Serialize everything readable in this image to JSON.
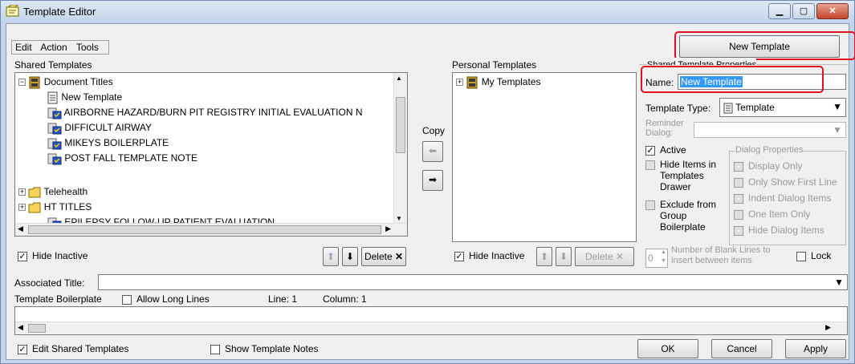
{
  "window": {
    "title": "Template Editor"
  },
  "menu": {
    "items": [
      "Edit",
      "Action",
      "Tools"
    ]
  },
  "toolbar": {
    "new_template_label": "New Template"
  },
  "shared": {
    "label": "Shared Templates",
    "tree": [
      {
        "label": "Document Titles",
        "expander": "−"
      },
      {
        "label": "New Template"
      },
      {
        "label": "AIRBORNE HAZARD/BURN PIT REGISTRY INITIAL EVALUATION N"
      },
      {
        "label": "DIFFICULT AIRWAY"
      },
      {
        "label": "MIKEYS BOILERPLATE"
      },
      {
        "label": "POST FALL TEMPLATE NOTE"
      },
      {
        "label": "Telehealth",
        "expander": "+"
      },
      {
        "label": "HT TITLES",
        "expander": "+"
      },
      {
        "label": "EPILEPSY FOLLOW-UP PATIENT EVALUATION"
      }
    ],
    "hide_inactive_label": "Hide Inactive",
    "delete_label": "Delete"
  },
  "copy": {
    "label": "Copy"
  },
  "personal": {
    "label": "Personal Templates",
    "tree": [
      {
        "label": "My Templates",
        "expander": "+"
      }
    ],
    "hide_inactive_label": "Hide Inactive",
    "delete_label": "Delete"
  },
  "properties": {
    "label": "Shared Template Properties",
    "name_label": "Name:",
    "name_value": "New Template",
    "template_type_label": "Template Type:",
    "template_type_value": "Template",
    "reminder_dialog_label": "Reminder Dialog:",
    "active_label": "Active",
    "hide_items_label": "Hide Items in Templates Drawer",
    "exclude_label": "Exclude from Group Boilerplate",
    "dialog_properties": {
      "label": "Dialog Properties",
      "options": [
        "Display Only",
        "Only Show First Line",
        "Indent Dialog Items",
        "One Item Only",
        "Hide Dialog Items"
      ]
    },
    "blank_lines_value": "0",
    "blank_lines_label": "Number of Blank Lines to insert between items",
    "lock_label": "Lock"
  },
  "associated_title": {
    "label": "Associated Title:",
    "value": ""
  },
  "boilerplate": {
    "label": "Template Boilerplate",
    "allow_long_lines_label": "Allow Long Lines",
    "line_label": "Line: 1",
    "column_label": "Column: 1"
  },
  "footer": {
    "edit_shared_label": "Edit Shared Templates",
    "show_notes_label": "Show Template Notes",
    "ok_label": "OK",
    "cancel_label": "Cancel",
    "apply_label": "Apply"
  },
  "colors": {
    "highlight_red": "#e3111d",
    "selection_blue": "#3399ff"
  }
}
